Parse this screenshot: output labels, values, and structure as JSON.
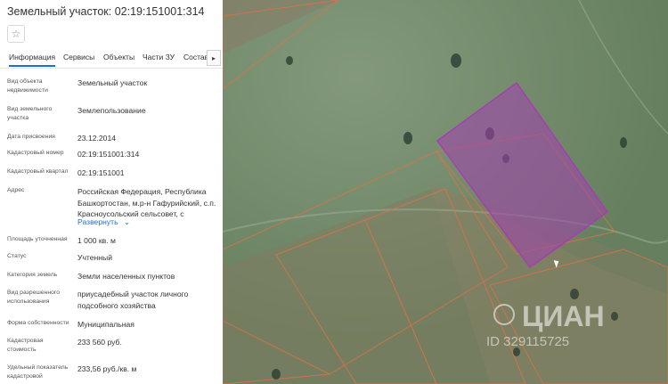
{
  "header": {
    "title": "Земельный участок: 02:19:151001:314",
    "favorite_icon": "star-icon"
  },
  "tabs": [
    "Информация",
    "Сервисы",
    "Объекты",
    "Части ЗУ",
    "Состав"
  ],
  "tabs_next_icon": "chevron-right-icon",
  "fields": [
    {
      "label": "Вид объекта недвижимости",
      "value": "Земельный участок"
    },
    {
      "label": "Вид земельного участка",
      "value": "Землепользование"
    },
    {
      "label": "Дата присвоения",
      "value": "23.12.2014"
    },
    {
      "label": "Кадастровый номер",
      "value": "02:19:151001:314"
    },
    {
      "label": "Кадастровый квартал",
      "value": "02:19:151001"
    },
    {
      "label": "Адрес",
      "value": "Российская Федерация, Республика Башкортостан, м.р-н Гафурийский, с.п. Красноусольский сельсовет, с"
    },
    {
      "label": "Площадь уточненная",
      "value": "1 000 кв. м"
    },
    {
      "label": "Статус",
      "value": "Учтенный"
    },
    {
      "label": "Категория земель",
      "value": "Земли населенных пунктов"
    },
    {
      "label": "Вид разрешенного использования",
      "value": "приусадебный участок личного подсобного хозяйства"
    },
    {
      "label": "Форма собственности",
      "value": "Муниципальная"
    },
    {
      "label": "Кадастровая стоимость",
      "value": "233 560 руб."
    },
    {
      "label": "Удельный показатель кадастровой",
      "value": "233,56 руб./кв. м"
    }
  ],
  "expand_link": "Развернуть",
  "map": {
    "watermark_brand": "ЦИАН",
    "watermark_id": "ID 329115725",
    "parcel_outline_color": "#d9734a",
    "selected_parcel_color": "#a33fb0"
  }
}
